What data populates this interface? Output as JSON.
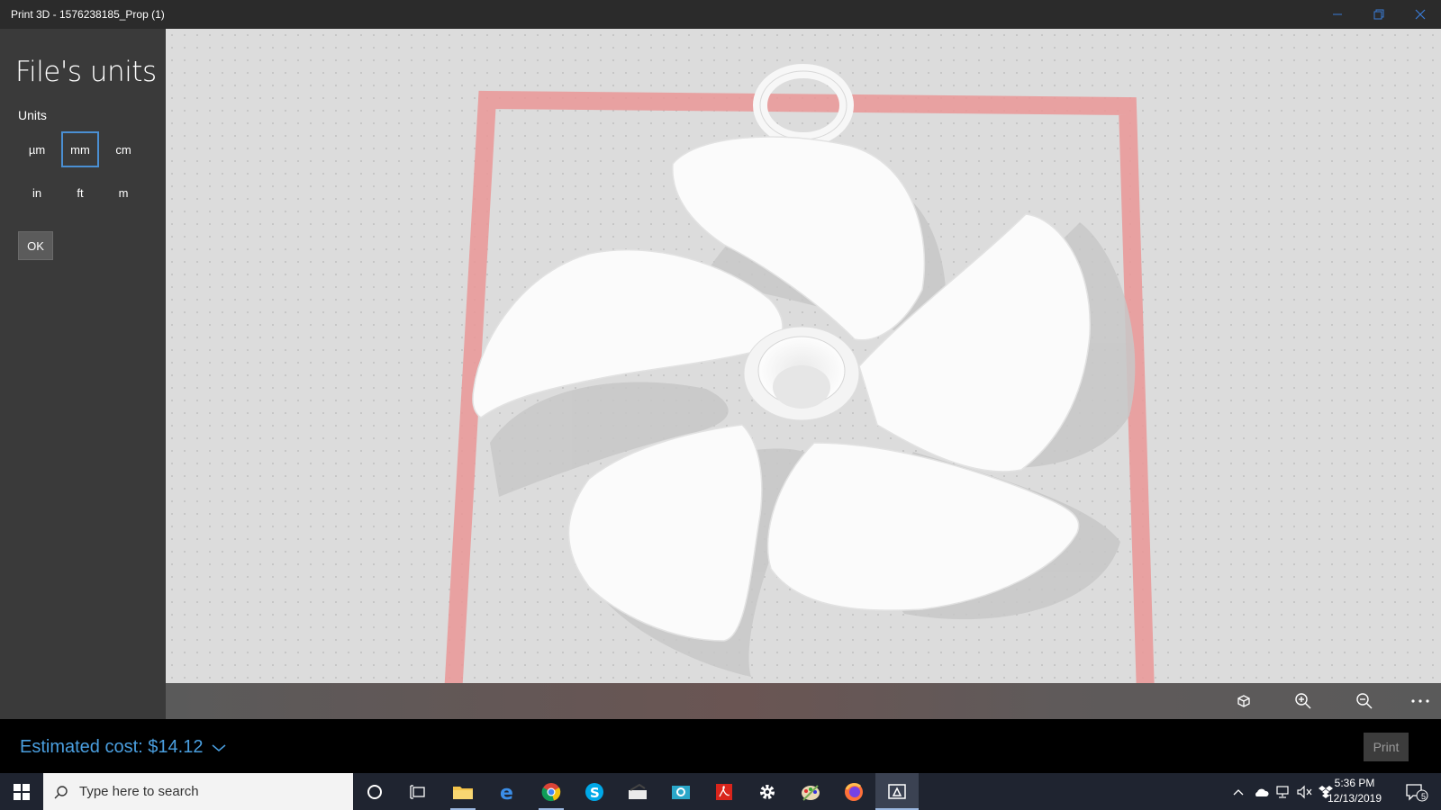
{
  "window": {
    "title": "Print 3D - 1576238185_Prop (1)"
  },
  "panel": {
    "heading": "File's units",
    "units_label": "Units",
    "units": [
      "µm",
      "mm",
      "cm",
      "in",
      "ft",
      "m"
    ],
    "selected_unit": "mm",
    "ok_label": "OK"
  },
  "bottom": {
    "cost_label": "Estimated cost: $14.12",
    "print_label": "Print"
  },
  "taskbar": {
    "search_placeholder": "Type here to search",
    "time": "5:36 PM",
    "date": "12/13/2019",
    "notification_count": "5"
  },
  "colors": {
    "accent": "#4a9fe0",
    "selected_border": "#4a8fd3",
    "print_bed": "#e99a9a",
    "model": "#ffffff"
  }
}
